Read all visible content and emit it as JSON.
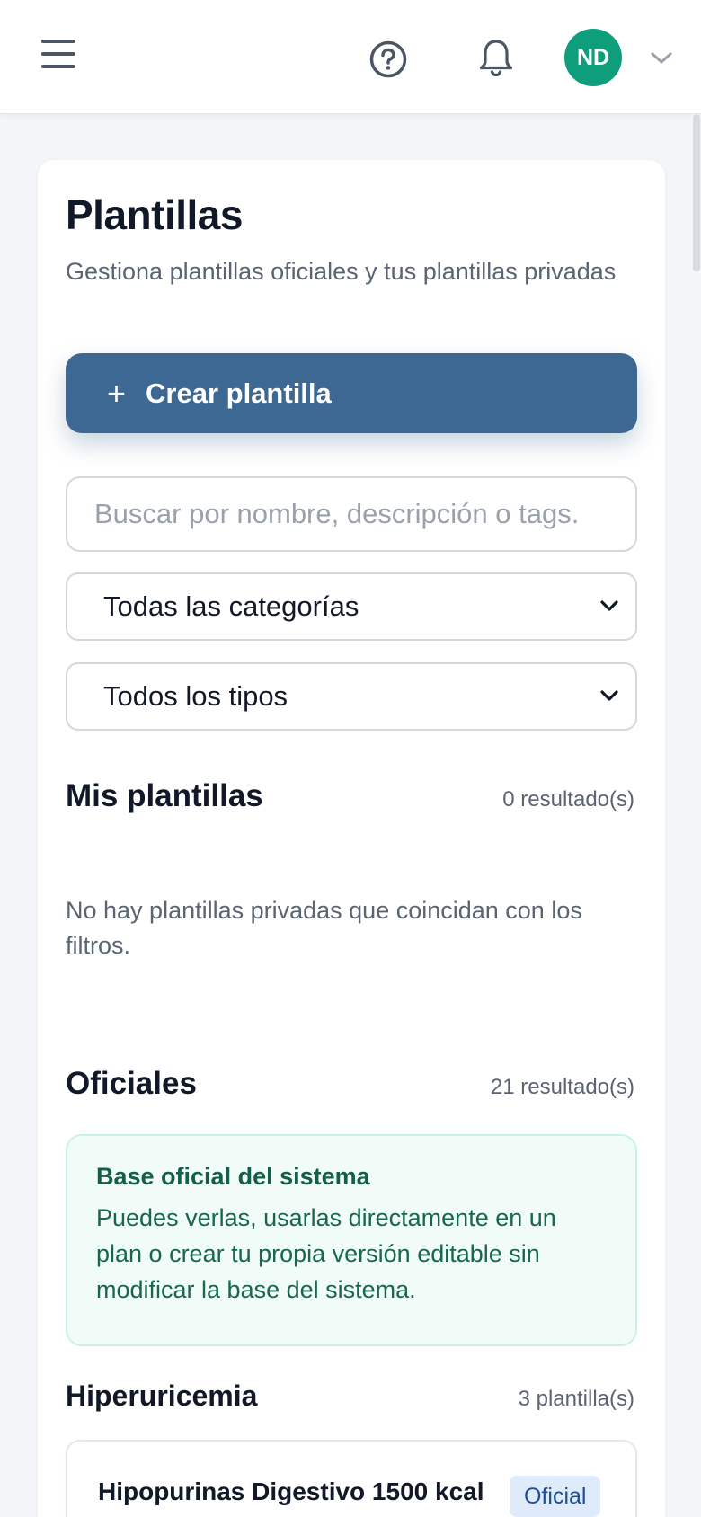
{
  "header": {
    "menu_icon": "hamburger-menu-icon",
    "help_icon": "help-circle-icon",
    "notifications_icon": "bell-icon",
    "avatar_initials": "ND",
    "avatar_color": "#0f9e7b",
    "dropdown_icon": "chevron-down-icon"
  },
  "page": {
    "title": "Plantillas",
    "subtitle": "Gestiona plantillas oficiales y tus plantillas privadas",
    "create_button": {
      "icon": "plus-icon",
      "label": "Crear plantilla",
      "color": "#3d6894"
    }
  },
  "filters": {
    "search_placeholder": "Buscar por nombre, descripción o tags.",
    "search_value": "",
    "category_selected": "Todas las categorías",
    "type_selected": "Todos los tipos"
  },
  "my_templates": {
    "title": "Mis plantillas",
    "count": "0 resultado(s)",
    "empty_message": "No hay plantillas privadas que coincidan con los filtros."
  },
  "official": {
    "title": "Oficiales",
    "count": "21 resultado(s)",
    "info_title": "Base oficial del sistema",
    "info_text": "Puedes verlas, usarlas directamente en un plan o crear tu propia versión editable sin modificar la base del sistema.",
    "groups": [
      {
        "title": "Hiperuricemia",
        "count": "3 plantilla(s)",
        "templates": [
          {
            "name": "Hipopurinas Digestivo 1500 kcal",
            "badge": "Oficial"
          }
        ]
      }
    ]
  }
}
